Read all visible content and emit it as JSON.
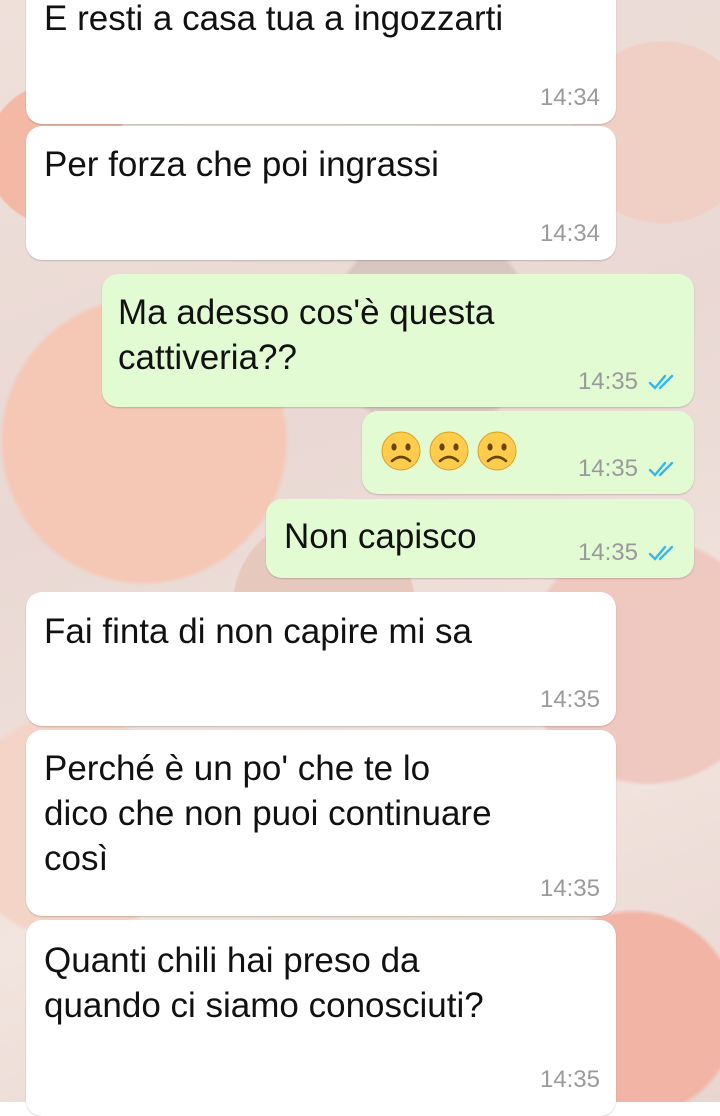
{
  "messages": [
    {
      "direction": "incoming",
      "text": "E resti a casa tua a ingozzarti",
      "time": "14:34"
    },
    {
      "direction": "incoming",
      "text": "Per forza che poi ingrassi",
      "time": "14:34"
    },
    {
      "direction": "outgoing",
      "text": "Ma adesso cos'è questa\ncattiveria??",
      "time": "14:35",
      "status": "read"
    },
    {
      "direction": "outgoing",
      "emoji": [
        "frowning-face",
        "frowning-face",
        "frowning-face"
      ],
      "time": "14:35",
      "status": "read"
    },
    {
      "direction": "outgoing",
      "text": "Non capisco",
      "time": "14:35",
      "status": "read"
    },
    {
      "direction": "incoming",
      "text": "Fai finta di non capire mi sa",
      "time": "14:35"
    },
    {
      "direction": "incoming",
      "text": "Perché è un po' che te lo\ndico che non puoi continuare\ncosì",
      "time": "14:35"
    },
    {
      "direction": "incoming",
      "text": "Quanti chili hai preso da\nquando ci siamo conosciuti?",
      "time": "14:35"
    }
  ],
  "colors": {
    "incoming_bubble": "#ffffff",
    "outgoing_bubble": "#e2fbd3",
    "timestamp": "#9a9a9a",
    "read_ticks": "#34b7f1",
    "emoji_fill": "#ffcc4d"
  }
}
